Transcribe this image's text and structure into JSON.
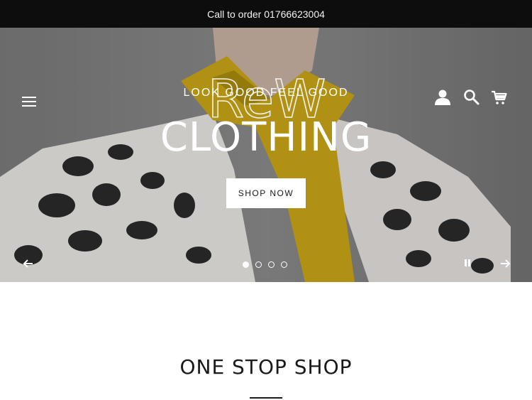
{
  "announcement": {
    "text": "Call to order 01766623004"
  },
  "header": {
    "logo_text": "ReW",
    "icons": {
      "menu": "hamburger-icon",
      "account": "user-icon",
      "search": "search-icon",
      "cart": "cart-icon"
    }
  },
  "slideshow": {
    "tagline": "LOOK GOOD FEEL GOOD",
    "headline": "CLOTHING",
    "cta_label": "SHOP NOW",
    "slide_count": 4,
    "active_slide": 1,
    "controls": {
      "prev": "arrow-left-icon",
      "next": "arrow-right-icon",
      "pause": "pause-icon"
    }
  },
  "section": {
    "title": "ONE STOP SHOP"
  },
  "colors": {
    "announcement_bg": "#0d0d0d",
    "hero_overlay_text": "#ffffff",
    "jacket_print": "#2b2b2b",
    "scarf": "#c9a616",
    "text": "#1a1a1a"
  }
}
